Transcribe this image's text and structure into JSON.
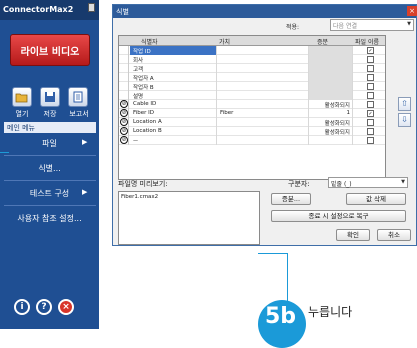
{
  "app": {
    "title": "ConnectorMax2",
    "live_video": "라이브 비디오",
    "icons": [
      {
        "icon": "open-icon",
        "label": "열기"
      },
      {
        "icon": "save-icon",
        "label": "저장"
      },
      {
        "icon": "report-icon",
        "label": "보고서"
      }
    ],
    "main_menu": "메인 메뉴",
    "menu": [
      "파일",
      "식별...",
      "테스트 구성",
      "사용자 참조 설정..."
    ],
    "footer_icons": [
      "info-icon",
      "help-icon",
      "close-icon"
    ]
  },
  "dialog": {
    "title": "식별",
    "apply_label": "적용:",
    "apply_value": "다음 연결",
    "columns": [
      "식별자",
      "가치",
      "증분",
      "파일 이름"
    ],
    "rows": [
      {
        "name": "작업 ID",
        "value": "",
        "inc": "",
        "file": true,
        "selected": true
      },
      {
        "name": "회사",
        "value": "",
        "inc": "",
        "file": false
      },
      {
        "name": "고객",
        "value": "",
        "inc": "",
        "file": false
      },
      {
        "name": "작업자 A",
        "value": "",
        "inc": "",
        "file": false
      },
      {
        "name": "작업자 B",
        "value": "",
        "inc": "",
        "file": false
      },
      {
        "name": "설명",
        "value": "",
        "inc": "",
        "file": false
      },
      {
        "name": "Cable ID",
        "value": "",
        "inc": "활성화되지",
        "file": false
      },
      {
        "name": "Fiber ID",
        "value": "Fiber",
        "inc": "1",
        "file": true
      },
      {
        "name": "Location A",
        "value": "",
        "inc": "활성화되지",
        "file": false
      },
      {
        "name": "Location B",
        "value": "",
        "inc": "활성화되지",
        "file": false
      },
      {
        "name": "ㅡ",
        "value": "",
        "inc": "",
        "file": false
      }
    ],
    "preview_label": "파일명 미리보기:",
    "preview_value": "Fiber1.cmax2",
    "separator_label": "구분자:",
    "separator_value": "밑줄 (_)",
    "btn_increment": "증분...",
    "btn_clear": "값 삭제",
    "btn_restore": "종료 시 설정으로 복구",
    "btn_ok": "확인",
    "btn_cancel": "취소"
  },
  "callout": {
    "step": "5b",
    "text": "누릅니다"
  }
}
